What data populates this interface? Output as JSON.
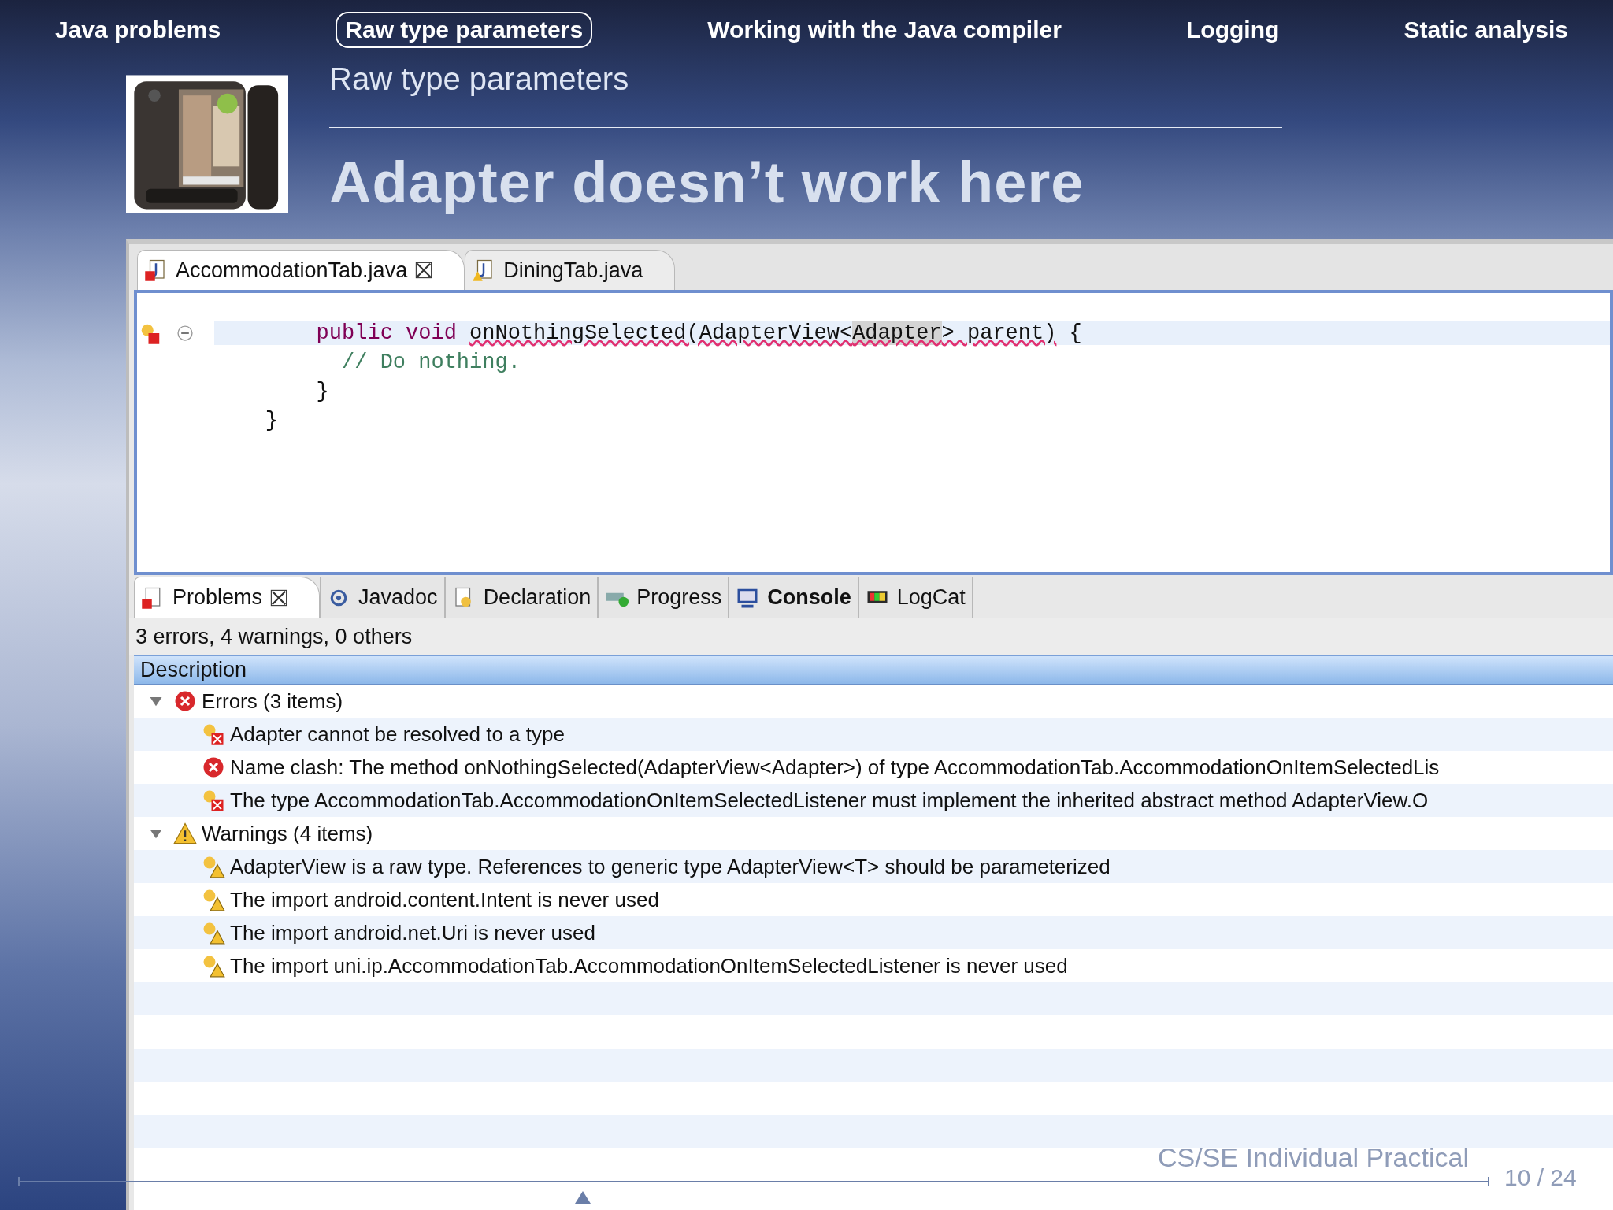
{
  "nav": [
    {
      "label": "Java problems",
      "selected": false
    },
    {
      "label": "Raw type parameters",
      "selected": true
    },
    {
      "label": "Working with the Java compiler",
      "selected": false
    },
    {
      "label": "Logging",
      "selected": false
    },
    {
      "label": "Static analysis",
      "selected": false
    }
  ],
  "slide": {
    "subtitle": "Raw type parameters",
    "title": "Adapter doesn’t work here"
  },
  "editor": {
    "tabs": [
      {
        "label": "AccommodationTab.java",
        "selected": true,
        "kind": "error",
        "closable": true
      },
      {
        "label": "DiningTab.java",
        "selected": false,
        "kind": "warning",
        "closable": false
      }
    ],
    "lines": [
      {
        "error": true,
        "current": true,
        "foldable": true,
        "tokens": [
          {
            "text": "        public void ",
            "kind": "keyword"
          },
          {
            "text": "onNothingSelected(AdapterView<",
            "kind": "error"
          },
          {
            "text": "Adapter",
            "kind": "occurrence"
          },
          {
            "text": "> parent)",
            "kind": "error"
          },
          {
            "text": " {",
            "kind": "plain"
          }
        ]
      },
      {
        "error": false,
        "current": false,
        "foldable": false,
        "tokens": [
          {
            "text": "          // Do nothing.",
            "kind": "comment"
          }
        ]
      },
      {
        "error": false,
        "current": false,
        "foldable": false,
        "tokens": [
          {
            "text": "        }",
            "kind": "plain"
          }
        ]
      },
      {
        "error": false,
        "current": false,
        "foldable": false,
        "tokens": [
          {
            "text": "    }",
            "kind": "plain"
          }
        ]
      }
    ]
  },
  "problems": {
    "tabs": [
      {
        "label": "Problems",
        "selected": true,
        "bold": false
      },
      {
        "label": "Javadoc",
        "selected": false,
        "bold": false
      },
      {
        "label": "Declaration",
        "selected": false,
        "bold": false
      },
      {
        "label": "Progress",
        "selected": false,
        "bold": false
      },
      {
        "label": "Console",
        "selected": false,
        "bold": true
      },
      {
        "label": "LogCat",
        "selected": false,
        "bold": false
      }
    ],
    "summary": "3 errors, 4 warnings, 0 others",
    "column": "Description",
    "groups": [
      {
        "label": "Errors (3 items)",
        "kind": "error",
        "expanded": true,
        "children": [
          {
            "label": "Adapter cannot be resolved to a type",
            "kind": "error-fix"
          },
          {
            "label": "Name clash: The method onNothingSelected(AdapterView<Adapter>) of type AccommodationTab.AccommodationOnItemSelectedLis",
            "kind": "error"
          },
          {
            "label": "The type AccommodationTab.AccommodationOnItemSelectedListener must implement the inherited abstract method AdapterView.O",
            "kind": "error-fix"
          }
        ]
      },
      {
        "label": "Warnings (4 items)",
        "kind": "warning",
        "expanded": true,
        "children": [
          {
            "label": "AdapterView is a raw type. References to generic type AdapterView<T> should be parameterized",
            "kind": "warning-fix"
          },
          {
            "label": "The import android.content.Intent is never used",
            "kind": "warning-fix"
          },
          {
            "label": "The import android.net.Uri is never used",
            "kind": "warning-fix"
          },
          {
            "label": "The import uni.ip.AccommodationTab.AccommodationOnItemSelectedListener is never used",
            "kind": "warning-fix"
          }
        ]
      }
    ]
  },
  "footer": {
    "course": "CS/SE Individual Practical",
    "page": "10 / 24"
  }
}
